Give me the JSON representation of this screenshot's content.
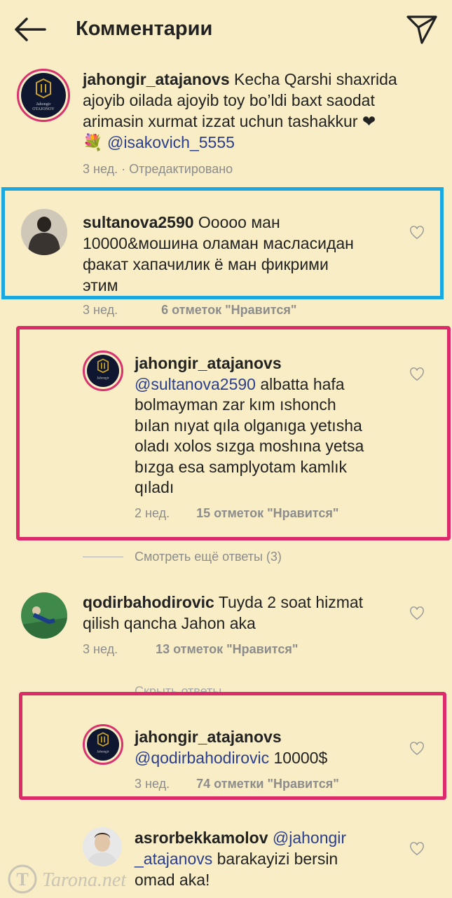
{
  "header": {
    "title": "Комментарии"
  },
  "caption": {
    "username": "jahongir_atajanovs",
    "line1_rest": " Kecha Qarshi shaxrida",
    "line2": "ajoyib oilada ajoyib toy bo’ldi baxt saodat",
    "line3": "arimasin xurmat izzat uchun tashakkur ❤",
    "mention": "@isakovich_5555",
    "bouquet": "💐",
    "meta": "3 нед. · Отредактировано",
    "avatar_text_1": "Jahongir",
    "avatar_text_2": "OTAJONOV"
  },
  "comment1": {
    "username": "sultanova2590",
    "line1_rest": " Ооооо ман",
    "line2": "10000&мошина оламан масласидан",
    "line3": "факат хапачилик ё ман фикрими",
    "line4": "этим",
    "time": "3 нед.",
    "likes": "6 отметок \"Нравится\""
  },
  "reply1": {
    "username": "jahongir_atajanovs",
    "mention": "@sultanova2590",
    "line1_rest": "  albatta hafa",
    "line2": "bolmayman zar kım ıshonch",
    "line3": "bılan nıyat qıla olganıga yetısha",
    "line4": "oladı xolos sızga moshına yetsa",
    "line5": "bızga esa samplyotam kamlık",
    "line6": "qıladı",
    "time": "2 нед.",
    "likes": "15 отметок \"Нравится\""
  },
  "more_replies": "Смотреть ещё ответы (3)",
  "comment2": {
    "username": "qodirbahodirovic",
    "line1_rest": " Tuyda 2 soat hizmat",
    "line2": "qilish qancha Jahon aka",
    "time": "3 нед.",
    "likes": "13 отметок \"Нравится\""
  },
  "hide_replies": "Скрыть ответы",
  "reply2": {
    "username": "jahongir_atajanovs",
    "mention": "@qodirbahodirovic",
    "rest": " 10000$",
    "time": "3 нед.",
    "likes": "74 отметки \"Нравится\""
  },
  "comment3": {
    "username": "asrorbekkamolov",
    "mention1": "@jahongir",
    "mention2": "_atajanovs",
    "line2_rest": " barakayizi bersin",
    "line3": "omad aka!"
  },
  "watermark": {
    "letter": "T",
    "text": "Tarona.net"
  },
  "colors": {
    "background": "#f8edc5",
    "blue_highlight": "#1aa8e0",
    "pink_highlight": "#dc2a6a",
    "mention": "#2a3e8f"
  }
}
